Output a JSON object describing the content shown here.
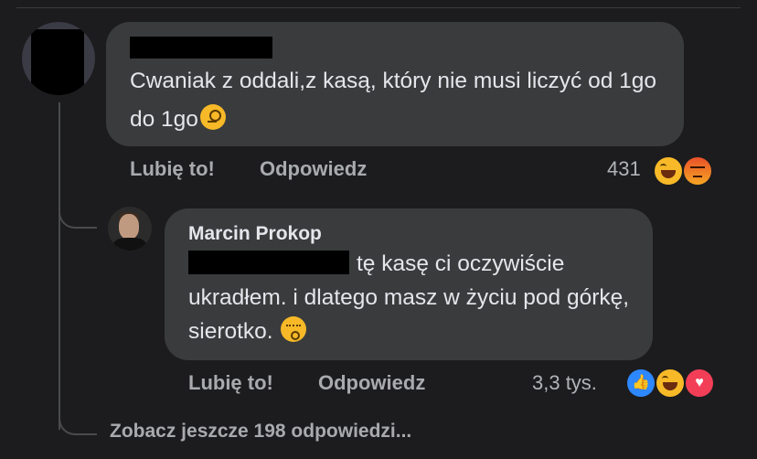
{
  "comment": {
    "text": "Cwaniak z oddali,z kasą, który nie musi liczyć od 1go do 1go",
    "emoji_inline": "monocle-face-icon",
    "actions": {
      "like_label": "Lubię to!",
      "reply_label": "Odpowiedz"
    },
    "reaction_count": "431",
    "reactions": [
      "haha-reaction-icon",
      "angry-reaction-icon"
    ]
  },
  "reply": {
    "author": "Marcin Prokop",
    "text": "tę kasę ci oczywiście ukradłem. i dlatego masz w życiu pod górkę, sierotko.",
    "emoji_inline": "kissing-face-icon",
    "actions": {
      "like_label": "Lubię to!",
      "reply_label": "Odpowiedz"
    },
    "reaction_count": "3,3 tys.",
    "reactions": [
      "like-reaction-icon",
      "haha-reaction-icon",
      "love-reaction-icon"
    ]
  },
  "more_replies": "Zobacz jeszcze 198 odpowiedzi..."
}
